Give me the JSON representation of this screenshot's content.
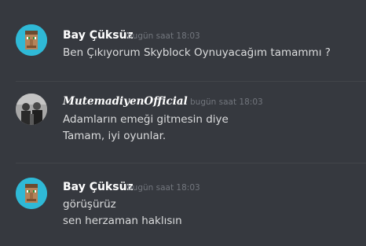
{
  "messages": [
    {
      "avatar_icon": "villager-avatar-icon",
      "username": "Bay Çüksüz",
      "timestamp": "bugün saat 18:03",
      "lines": [
        "Ben Çıkıyorum Skyblock Oynuyacağım tamammı ?"
      ]
    },
    {
      "avatar_icon": "person-photo-avatar-icon",
      "username": "MutemadiyenOfficial",
      "timestamp": "bugün saat 18:03",
      "lines": [
        "Adamların emeği gitmesin diye",
        "Tamam, iyi oyunlar."
      ]
    },
    {
      "avatar_icon": "villager-avatar-icon",
      "username": "Bay Çüksüz",
      "timestamp": "bugün saat 18:03",
      "lines": [
        "görüşürüz",
        "sen herzaman haklısın"
      ]
    }
  ],
  "colors": {
    "background": "#36393f",
    "username": "#ffffff",
    "message_text": "#dcddde",
    "timestamp": "#72767d",
    "divider": "#42454a",
    "villager_bg": "#2fb9d6"
  }
}
